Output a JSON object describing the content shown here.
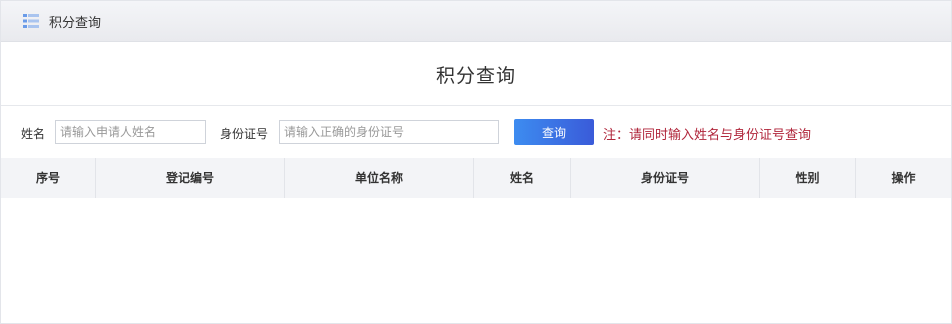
{
  "topbar": {
    "icon": "list-icon",
    "title": "积分查询"
  },
  "page": {
    "title": "积分查询"
  },
  "search": {
    "name_label": "姓名",
    "name_placeholder": "请输入申请人姓名",
    "id_label": "身份证号",
    "id_placeholder": "请输入正确的身份证号",
    "query_button": "查询",
    "note": "注：请同时输入姓名与身份证号查询"
  },
  "table": {
    "columns": [
      "序号",
      "登记编号",
      "单位名称",
      "姓名",
      "身份证号",
      "性别",
      "操作"
    ],
    "rows": []
  },
  "colors": {
    "accent": "#3a6ee8",
    "note": "#b0263b",
    "header_bg": "#f3f4f7"
  }
}
